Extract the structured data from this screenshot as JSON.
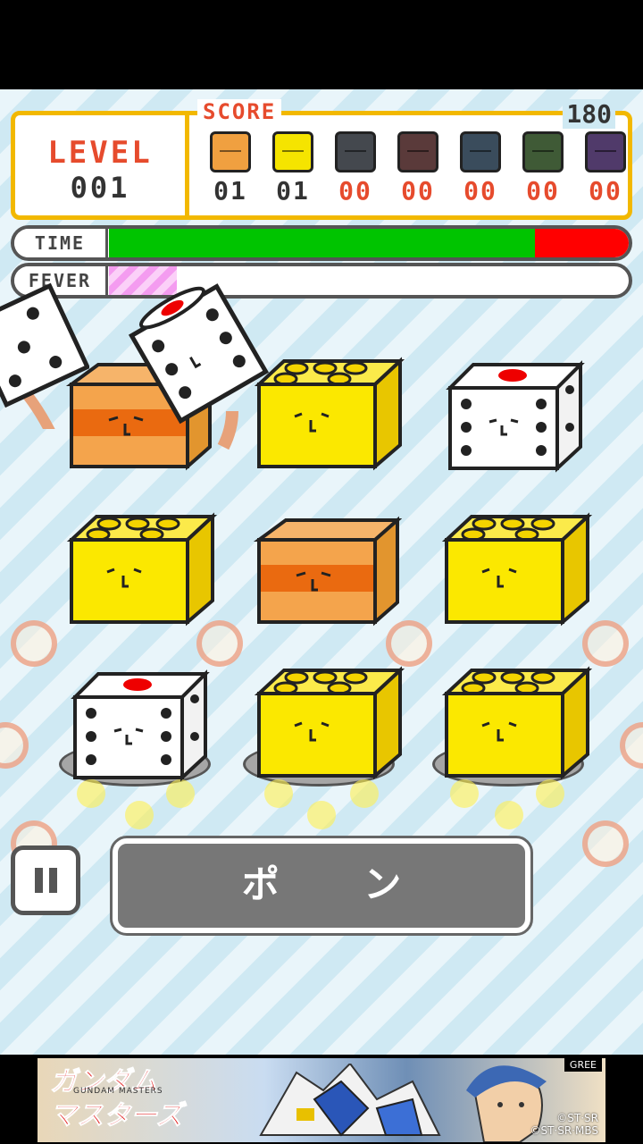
{
  "header": {
    "level_label": "LEVEL",
    "level_value": "001",
    "score_label": "SCORE",
    "score_value": "180"
  },
  "counters": [
    {
      "icon": "cardboard-box-icon",
      "count": "01",
      "color": "#333333",
      "bg": "#f0a040"
    },
    {
      "icon": "yellow-brick-icon",
      "count": "01",
      "color": "#333333",
      "bg": "#f5e400"
    },
    {
      "icon": "gray-game-console-icon",
      "count": "00",
      "color": "#e64b2d",
      "bg": "#44484e"
    },
    {
      "icon": "red-gift-box-icon",
      "count": "00",
      "color": "#e64b2d",
      "bg": "#5a3a3a"
    },
    {
      "icon": "blue-block-icon",
      "count": "00",
      "color": "#e64b2d",
      "bg": "#3a4c5c"
    },
    {
      "icon": "green-block-icon",
      "count": "00",
      "color": "#e64b2d",
      "bg": "#3f5a36"
    },
    {
      "icon": "purple-block-icon",
      "count": "00",
      "color": "#e64b2d",
      "bg": "#503a6a"
    }
  ],
  "time_bar": {
    "label": "TIME",
    "remaining": 0.82,
    "used": 0.18
  },
  "fever_bar": {
    "label": "FEVER",
    "level": 0.13
  },
  "buttons": {
    "pon_label": "ポ ン"
  },
  "ad": {
    "title_line1": "ガンダム",
    "title_line2": "マスターズ",
    "subtitle": "GUNDAM MASTERS",
    "publisher": "GREE",
    "copyright_line1": "©ST·SR",
    "copyright_line2": "©ST·SR·MBS"
  },
  "colors": {
    "accent_yellow": "#f2b800",
    "accent_red": "#e64b2d",
    "time_green": "#00c400",
    "time_red": "#ff0000"
  }
}
